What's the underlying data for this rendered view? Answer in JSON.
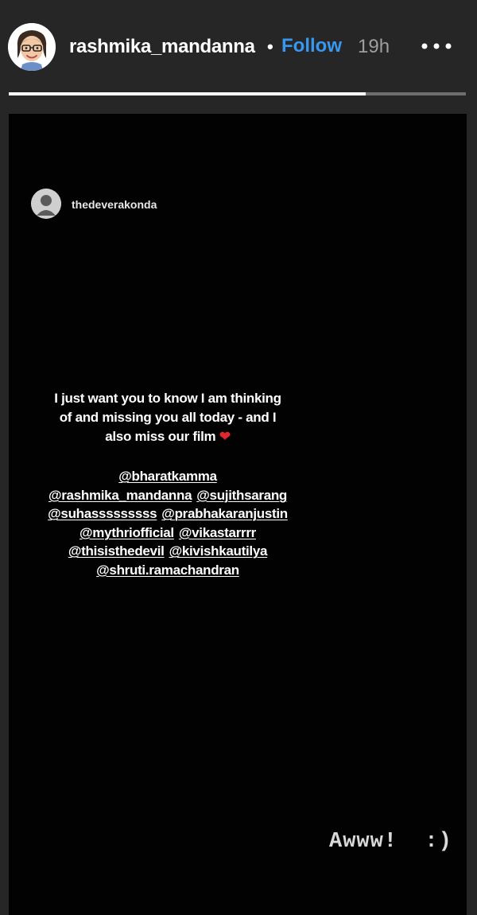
{
  "header": {
    "username": "rashmika_mandanna",
    "separator": "•",
    "follow_label": "Follow",
    "timestamp": "19h",
    "more_icon": "more-horizontal-icon"
  },
  "progress": {
    "fraction": 0.78
  },
  "story": {
    "shared_post": {
      "username": "thedeverakonda",
      "caption_lines": [
        "I just want you to know I am thinking",
        "of and missing you all today - and I",
        "also miss our film"
      ],
      "heart_emoji": "❤",
      "mention_lines": [
        [
          "@bharatkamma"
        ],
        [
          "@rashmika_mandanna",
          "@sujithsarang"
        ],
        [
          "@suhasssssssss",
          "@prabhakaranjustin"
        ],
        [
          "@mythriofficial",
          "@vikastarrrr"
        ],
        [
          "@thisisthedevil",
          "@kivishkautilya"
        ],
        [
          "@shruti.ramachandran"
        ]
      ]
    },
    "overlay_text": "Awww!  :)"
  },
  "colors": {
    "background": "#262626",
    "story_background": "#020202",
    "follow": "#3897f0",
    "heart": "#e0262f"
  }
}
